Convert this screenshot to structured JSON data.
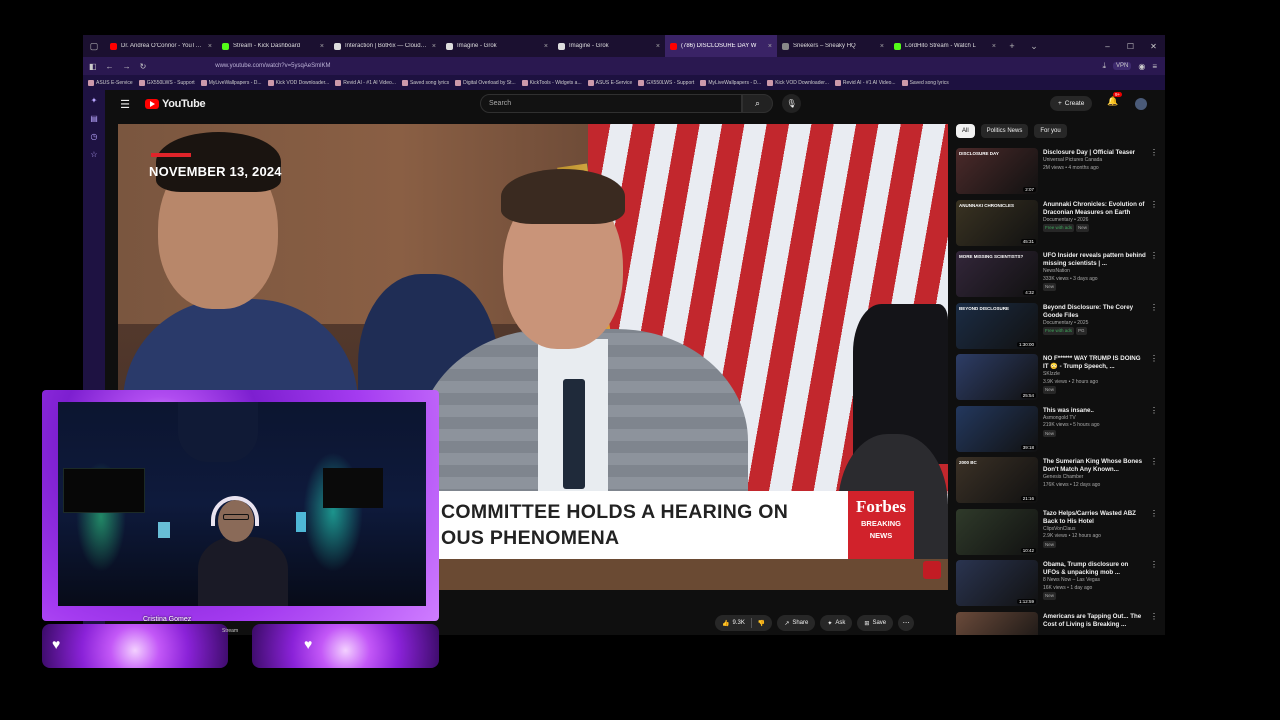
{
  "browser": {
    "tabs": [
      {
        "label": "Dr. Andrea O'Connor - YouTube",
        "color": "#ff0000"
      },
      {
        "label": "Stream - Kick Dashboard",
        "color": "#53fc18"
      },
      {
        "label": "Interaction | BotRix — Cloud St",
        "color": "#dddddd"
      },
      {
        "label": "Imagine - Grok",
        "color": "#dddddd"
      },
      {
        "label": "Imagine - Grok",
        "color": "#dddddd"
      },
      {
        "label": "(786) DISCLOSURE DAY W",
        "color": "#ff0000",
        "active": true
      },
      {
        "label": "Sneekers – Sneaky HQ",
        "color": "#888888"
      },
      {
        "label": "LordHito Stream - Watch L",
        "color": "#53fc18"
      }
    ],
    "url": "www.youtube.com/watch?v=5ysqAeSmlKM",
    "vpn_label": "VPN",
    "bookmarks": [
      "ASUS E-Service",
      "GX550LWS - Support",
      "MyLiveWallpapers - D...",
      "Kick VOD Downloader...",
      "Revid AI - #1 AI Video...",
      "Saved song lyrics",
      "Digital Overload by St...",
      "KickTools - Widgets a...",
      "ASUS E-Service",
      "GX550LWS - Support",
      "MyLiveWallpapers - D...",
      "Kick VOD Downloader...",
      "Revid AI - #1 AI Video...",
      "Saved song lyrics"
    ]
  },
  "youtube": {
    "logo_text": "YouTube",
    "search_placeholder": "Search",
    "create_label": "Create",
    "notif_count": "9+"
  },
  "video": {
    "date_text": "NOVEMBER 13, 2024",
    "lower_third_line1": "COMMITTEE HOLDS A HEARING ON",
    "lower_third_line2": "OUS PHENOMENA",
    "forbes_brand": "Forbes",
    "forbes_tag1": "BREAKING",
    "forbes_tag2": "NEWS"
  },
  "actions": {
    "likes": "9.3K",
    "share": "Share",
    "ask": "Ask",
    "save": "Save"
  },
  "chips": [
    "All",
    "Politics News",
    "For you"
  ],
  "recommendations": [
    {
      "title": "Disclosure Day | Official Teaser",
      "channel": "Universal Pictures Canada",
      "views": "2M views • 4 months ago",
      "duration": "2:07",
      "overlay": "DISCLOSURE DAY",
      "thumb_color": "#4b2a2a",
      "badges": []
    },
    {
      "title": "Anunnaki Chronicles: Evolution of Draconian Measures on Earth",
      "channel": "Documentary • 2026",
      "views": "",
      "duration": "45:31",
      "overlay": "ANUNNAKI CHRONICLES",
      "thumb_color": "#3a3322",
      "badges": [
        "Free with ads",
        "New"
      ]
    },
    {
      "title": "UFO Insider reveals pattern behind missing scientists | ...",
      "channel": "NewsNation",
      "views": "333K views • 3 days ago",
      "duration": "4:32",
      "overlay": "MORE MISSING SCIENTISTS?",
      "thumb_color": "#33263a",
      "badges": [
        "New"
      ]
    },
    {
      "title": "Beyond Disclosure: The Corey Goode Files",
      "channel": "Documentary • 2025",
      "views": "",
      "duration": "1:30:00",
      "overlay": "BEYOND DISCLOSURE",
      "thumb_color": "#1b2c44",
      "badges": [
        "Free with ads",
        "PG"
      ]
    },
    {
      "title": "NO F****** WAY TRUMP IS DOING IT 😳 - Trump Speech, ...",
      "channel": "SKIzzle",
      "views": "3.9K views • 2 hours ago",
      "duration": "25:54",
      "overlay": "",
      "thumb_color": "#2d3d66",
      "badges": [
        "New"
      ]
    },
    {
      "title": "This was insane..",
      "channel": "Asmongold TV",
      "views": "219K views • 5 hours ago",
      "duration": "39:18",
      "overlay": "",
      "thumb_color": "#23385e",
      "badges": [
        "New"
      ]
    },
    {
      "title": "The Sumerian King Whose Bones Don't Match Any Known...",
      "channel": "Genesis Chamber",
      "views": "176K views • 12 days ago",
      "duration": "21:16",
      "overlay": "2000 BC",
      "thumb_color": "#3b3126",
      "badges": []
    },
    {
      "title": "Tazo Helps/Carries Wasted ABZ Back to His Hotel",
      "channel": "ClipsVonClaus",
      "views": "2.9K views • 12 hours ago",
      "duration": "10:42",
      "overlay": "",
      "thumb_color": "#2f3a2a",
      "badges": [
        "New"
      ]
    },
    {
      "title": "Obama, Trump disclosure on UFOs & unpacking mob ...",
      "channel": "8 News Now – Las Vegas",
      "views": "16K views • 1 day ago",
      "duration": "1:12:59",
      "overlay": "",
      "thumb_color": "#2a3450",
      "badges": [
        "New"
      ]
    },
    {
      "title": "Americans are Tapping Out... The Cost of Living is Breaking ...",
      "channel": "",
      "views": "",
      "duration": "",
      "overlay": "",
      "thumb_color": "#6a4a3a",
      "badges": []
    }
  ],
  "webcam": {
    "name": "Cristina Gomez",
    "tag": "Stream"
  }
}
